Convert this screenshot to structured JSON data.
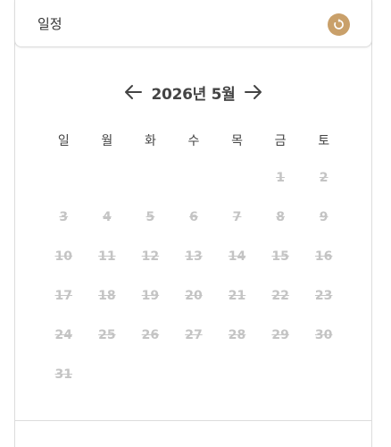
{
  "header": {
    "title": "일정"
  },
  "calendar": {
    "month_label": "2026년 5월",
    "weekdays": [
      "일",
      "월",
      "화",
      "수",
      "목",
      "금",
      "토"
    ],
    "weeks": [
      [
        "",
        "",
        "",
        "",
        "",
        "1",
        "2"
      ],
      [
        "3",
        "4",
        "5",
        "6",
        "7",
        "8",
        "9"
      ],
      [
        "10",
        "11",
        "12",
        "13",
        "14",
        "15",
        "16"
      ],
      [
        "17",
        "18",
        "19",
        "20",
        "21",
        "22",
        "23"
      ],
      [
        "24",
        "25",
        "26",
        "27",
        "28",
        "29",
        "30"
      ],
      [
        "31",
        "",
        "",
        "",
        "",
        "",
        ""
      ]
    ]
  },
  "colors": {
    "accent": "#c9a06a",
    "disabled_day": "#c4c4c4"
  },
  "icons": {
    "reset": "refresh-icon",
    "prev": "arrow-left-icon",
    "next": "arrow-right-icon"
  }
}
